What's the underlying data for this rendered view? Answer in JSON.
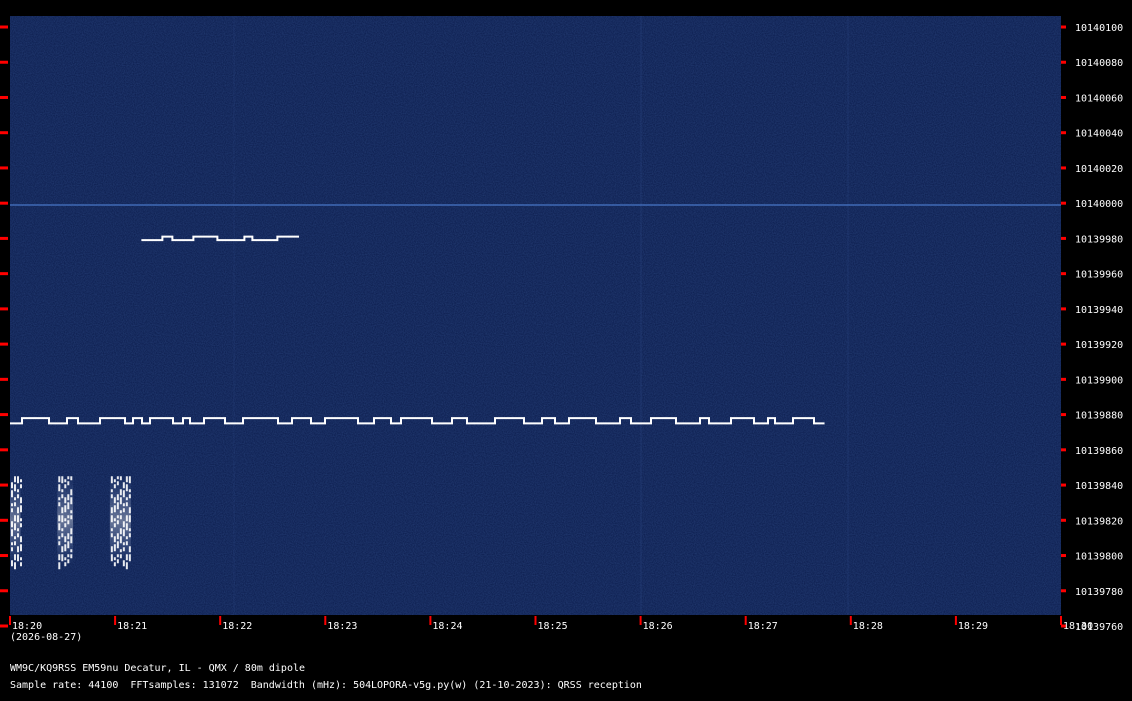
{
  "chart_data": {
    "type": "heatmap",
    "title": "",
    "xlabel": "",
    "ylabel": "",
    "x_tick_labels": [
      "18:20",
      "18:21",
      "18:22",
      "18:23",
      "18:24",
      "18:25",
      "18:26",
      "18:27",
      "18:28",
      "18:29",
      "18:30"
    ],
    "y_tick_labels": [
      "10140100",
      "10140080",
      "10140060",
      "10140040",
      "10140020",
      "10140000",
      "10139980",
      "10139960",
      "10139940",
      "10139920",
      "10139900",
      "10139880",
      "10139860",
      "10139840",
      "10139820",
      "10139800",
      "10139780",
      "10139760"
    ],
    "ylim": [
      10139760,
      10140100
    ],
    "xlim_minutes": [
      0,
      10
    ],
    "colors": {
      "background": "#0a1a4a",
      "signal": "#ffffff",
      "tick": "#ff0000"
    },
    "signals": [
      {
        "name": "",
        "freq": 10139875,
        "t_start": 0.0,
        "t_end": 7.75,
        "shift": 3,
        "kind": "fsk"
      },
      {
        "name": "",
        "freq": 10139979,
        "t_start": 1.25,
        "t_end": 2.75,
        "shift": 2,
        "kind": "fsk"
      },
      {
        "name": "",
        "freq": 10139999,
        "t_start": 0.0,
        "t_end": 10.0,
        "shift": 0,
        "kind": "carrier"
      },
      {
        "name": "",
        "freq": 10139820,
        "t_start": 0.0,
        "t_end": 0.1,
        "width_hz": 50,
        "kind": "burst"
      },
      {
        "name": "",
        "freq": 10139820,
        "t_start": 0.45,
        "t_end": 0.6,
        "width_hz": 50,
        "kind": "burst"
      },
      {
        "name": "",
        "freq": 10139820,
        "t_start": 0.95,
        "t_end": 1.15,
        "width_hz": 50,
        "kind": "burst"
      }
    ]
  },
  "date": "(2026-08-27)",
  "footer": {
    "station": "WM9C/KQ9RSS EM59nu Decatur, IL - QMX / 80m dipole",
    "sample_rate": "Sample rate: 44100",
    "fft_samples": "FFTsamples: 131072",
    "bandwidth": "Bandwidth (mHz): 504",
    "software": "LOPORA-v5g.py(w) (21-10-2023): QRSS reception"
  }
}
